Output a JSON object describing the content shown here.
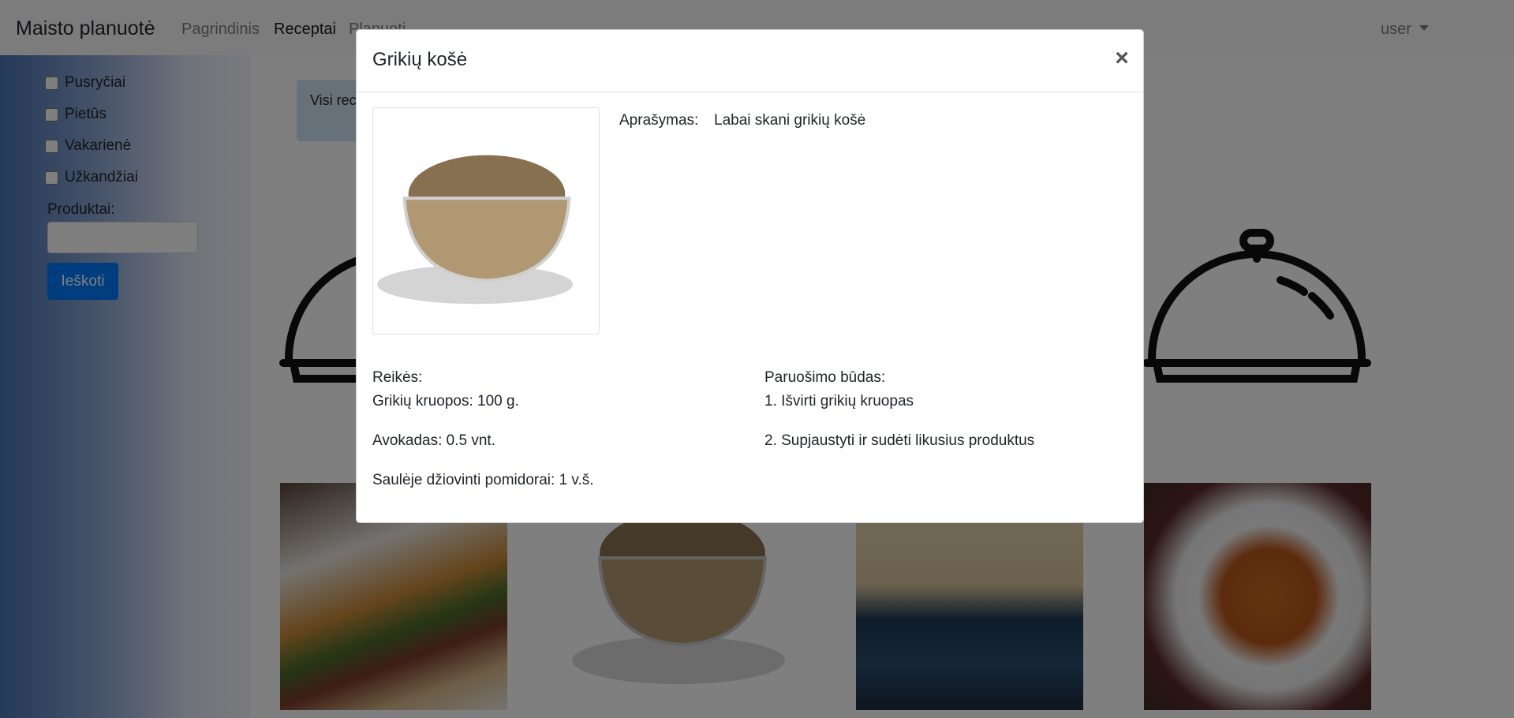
{
  "navbar": {
    "brand": "Maisto planuotė",
    "links": [
      "Pagrindinis",
      "Receptai",
      "Planuoti"
    ],
    "user": "user"
  },
  "sidebar": {
    "filters": [
      "Pusryčiai",
      "Pietūs",
      "Vakarienė",
      "Užkandžiai"
    ],
    "products_label": "Produktai:",
    "products_value": "",
    "search_button": "Ieškoti"
  },
  "main": {
    "all_recipes_label": "Visi receptai"
  },
  "modal": {
    "title": "Grikių košė",
    "close": "×",
    "description_label": "Aprašymas:",
    "description": "Labai skani grikių košė",
    "ingredients_title": "Reikės:",
    "ingredients": [
      "Grikių kruopos: 100 g.",
      "Avokadas: 0.5 vnt.",
      "Saulėje džiovinti pomidorai: 1 v.š."
    ],
    "preparation_title": "Paruošimo būdas:",
    "steps": [
      "1. Išvirti grikių kruopas",
      "2. Supjaustyti ir sudėti likusius produktus"
    ]
  },
  "colors": {
    "primary": "#007bff",
    "backdrop": "rgba(0,0,0,0.5)"
  }
}
